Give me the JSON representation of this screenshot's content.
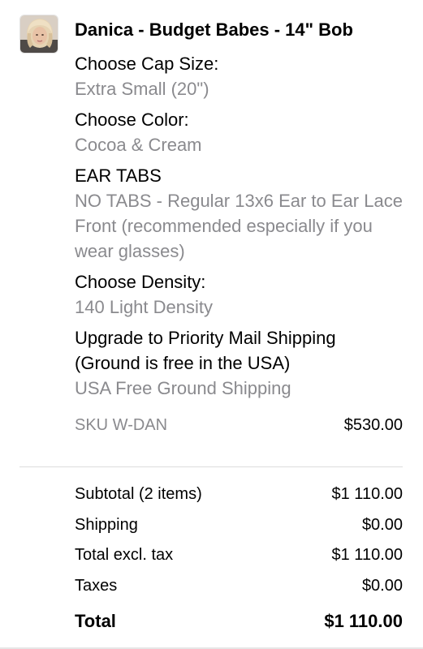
{
  "line_item": {
    "title": "Danica - Budget Babes - 14\" Bob",
    "options": [
      {
        "label": "Choose Cap Size:",
        "value": "Extra Small (20\")"
      },
      {
        "label": "Choose Color:",
        "value": "Cocoa & Cream"
      },
      {
        "label": "EAR TABS",
        "value": "NO TABS - Regular 13x6 Ear to Ear Lace Front (recommended especially if you wear glasses)"
      },
      {
        "label": "Choose Density:",
        "value": "140 Light Density"
      },
      {
        "label": "Upgrade to Priority Mail Shipping (Ground is free in the USA)",
        "value": "USA Free Ground Shipping"
      }
    ],
    "sku": "SKU W-DAN",
    "price": "$530.00"
  },
  "summary": {
    "rows": [
      {
        "label": "Subtotal (2 items)",
        "value": "$1 110.00"
      },
      {
        "label": "Shipping",
        "value": "$0.00"
      },
      {
        "label": "Total excl. tax",
        "value": "$1 110.00"
      },
      {
        "label": "Taxes",
        "value": "$0.00"
      }
    ],
    "total_label": "Total",
    "total_value": "$1 110.00"
  },
  "colors": {
    "primary_text": "#000000",
    "secondary_text": "#8a8a8e",
    "divider": "#dcdcdc"
  }
}
